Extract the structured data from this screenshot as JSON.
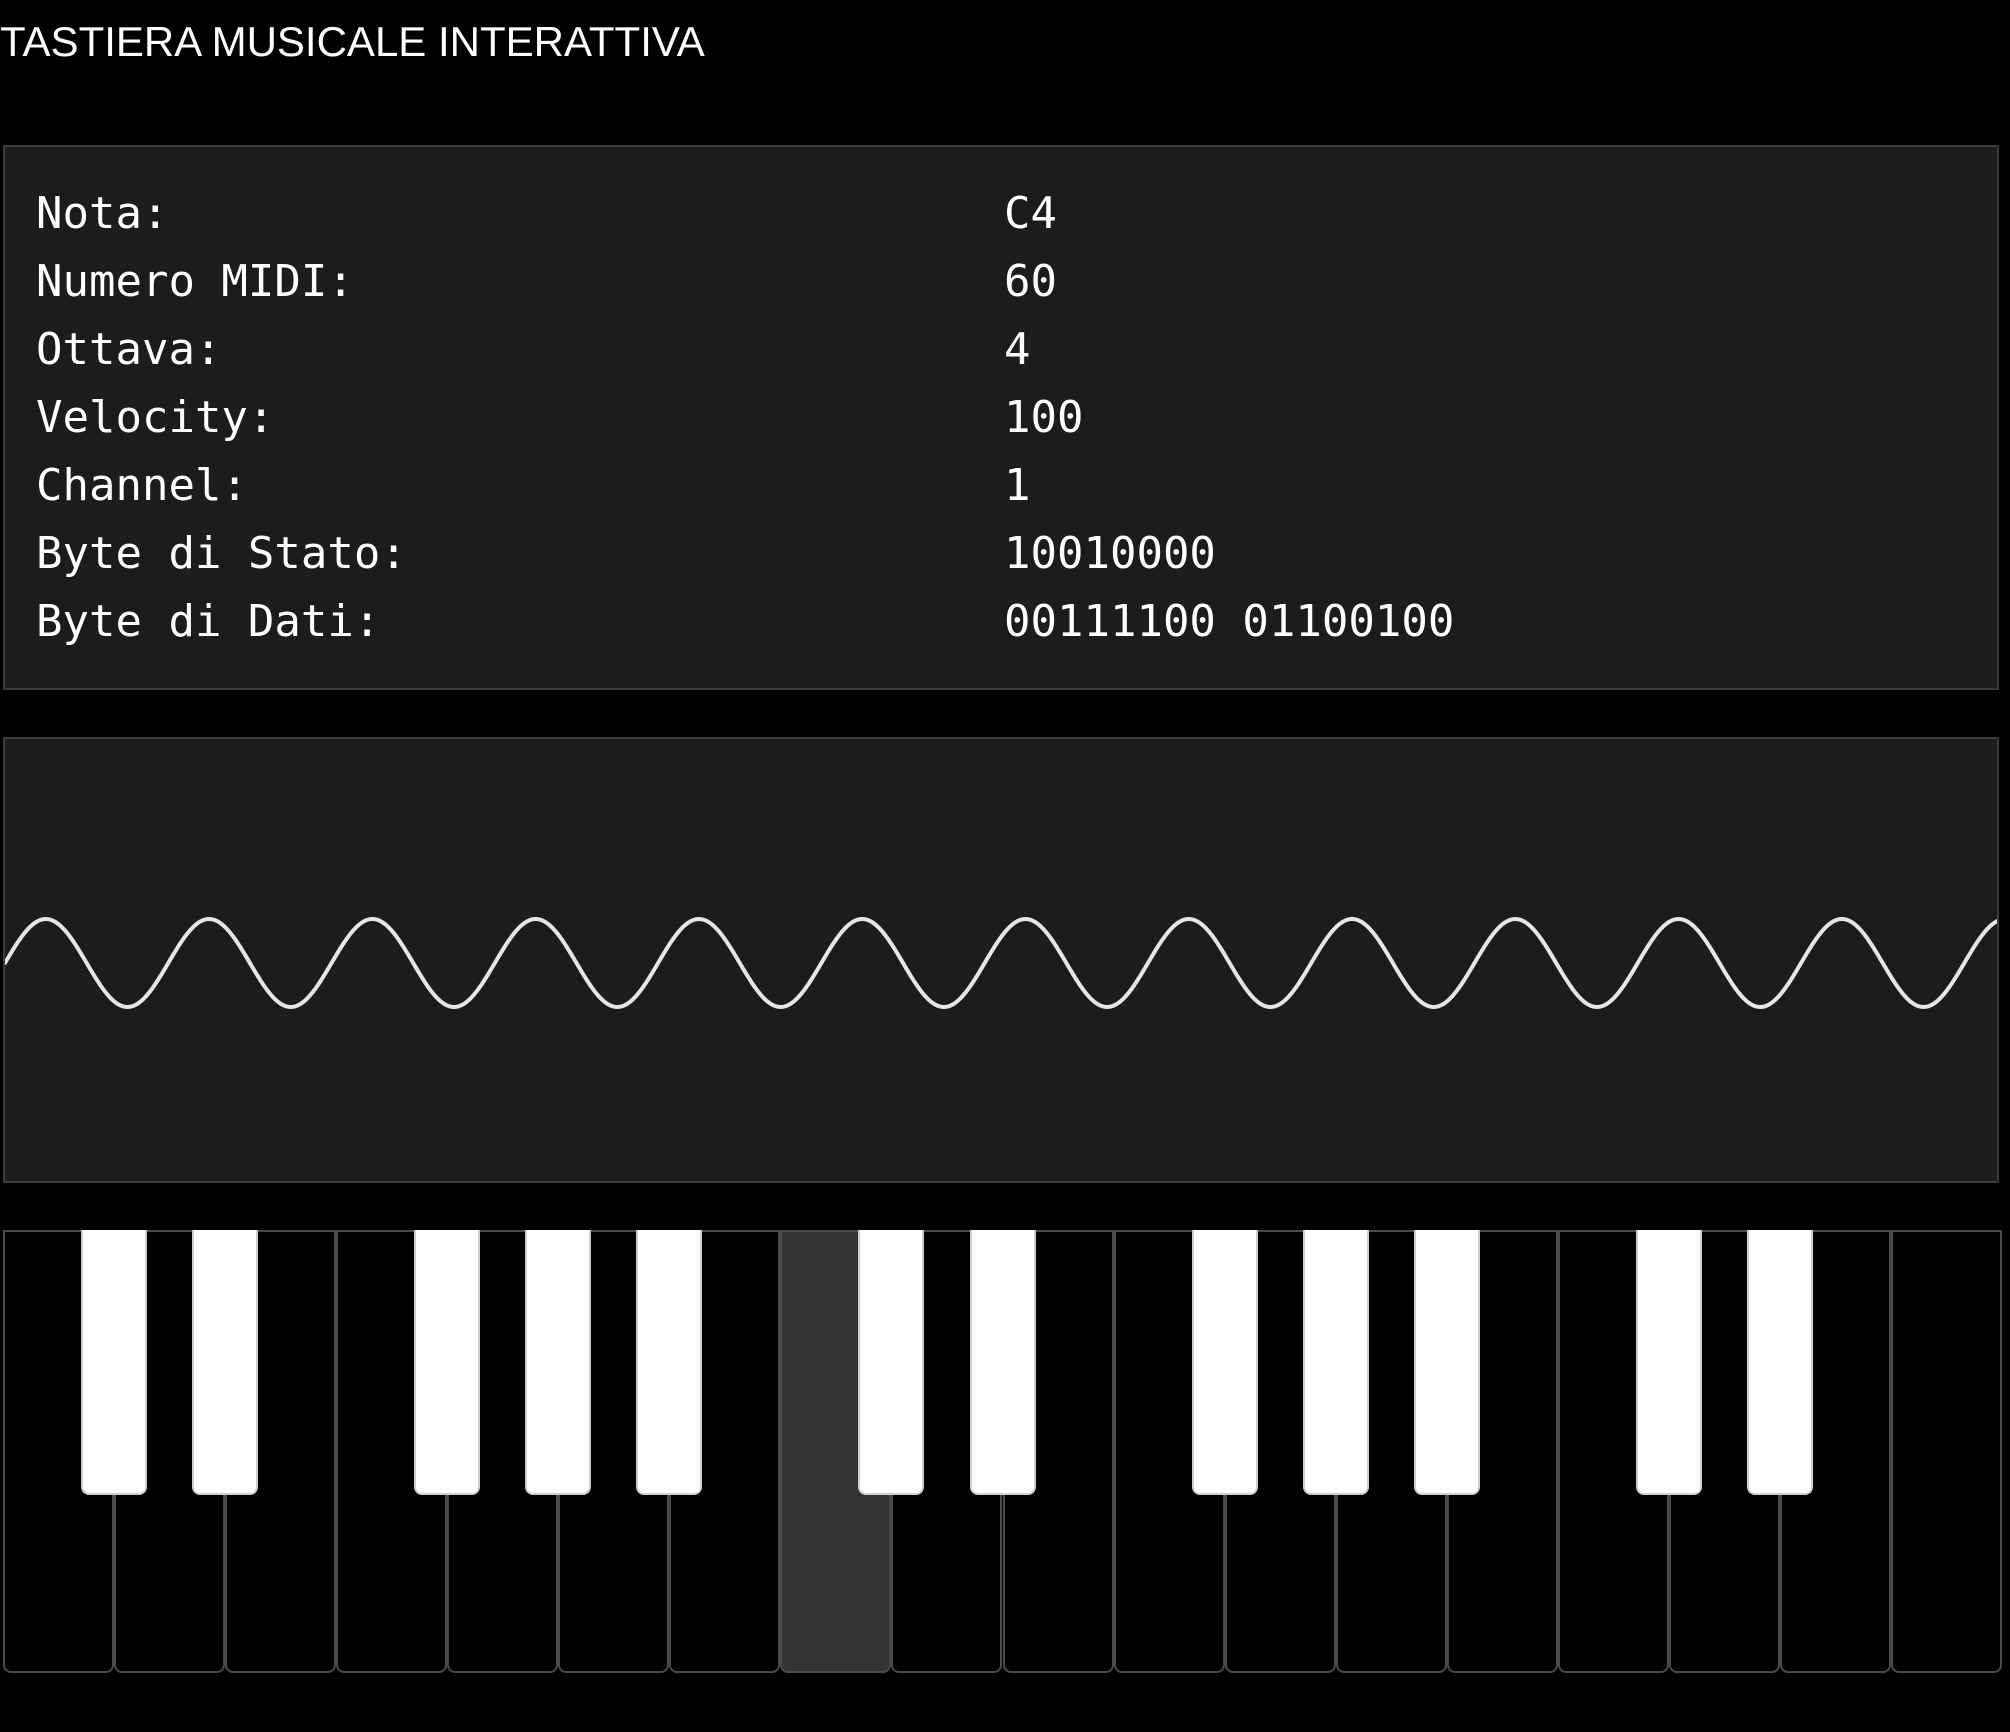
{
  "page": {
    "title": "TASTIERA MUSICALE INTERATTIVA"
  },
  "info": {
    "rows": [
      {
        "label": "Nota:",
        "value": "C4"
      },
      {
        "label": "Numero MIDI:",
        "value": "60"
      },
      {
        "label": "Ottava:",
        "value": "4"
      },
      {
        "label": "Velocity:",
        "value": "100"
      },
      {
        "label": "Channel:",
        "value": "1"
      },
      {
        "label": "Byte di Stato:",
        "value": "10010000"
      },
      {
        "label": "Byte di Dati:",
        "value": "00111100 01100100"
      }
    ]
  },
  "waveform": {
    "shape": "sine",
    "color": "#e6e6e6",
    "cycles": 12.2
  },
  "keyboard": {
    "lower_key_count": 18,
    "active_lower_key": 7,
    "upper_key_groups": [
      [
        1,
        2
      ],
      [
        4,
        5,
        6
      ],
      [
        8,
        9
      ],
      [
        11,
        12,
        13
      ],
      [
        15,
        16
      ]
    ],
    "colors": {
      "lower": "#000000",
      "lower_active": "#333333",
      "upper": "#ffffff",
      "divider": "#4a4a4a"
    }
  }
}
